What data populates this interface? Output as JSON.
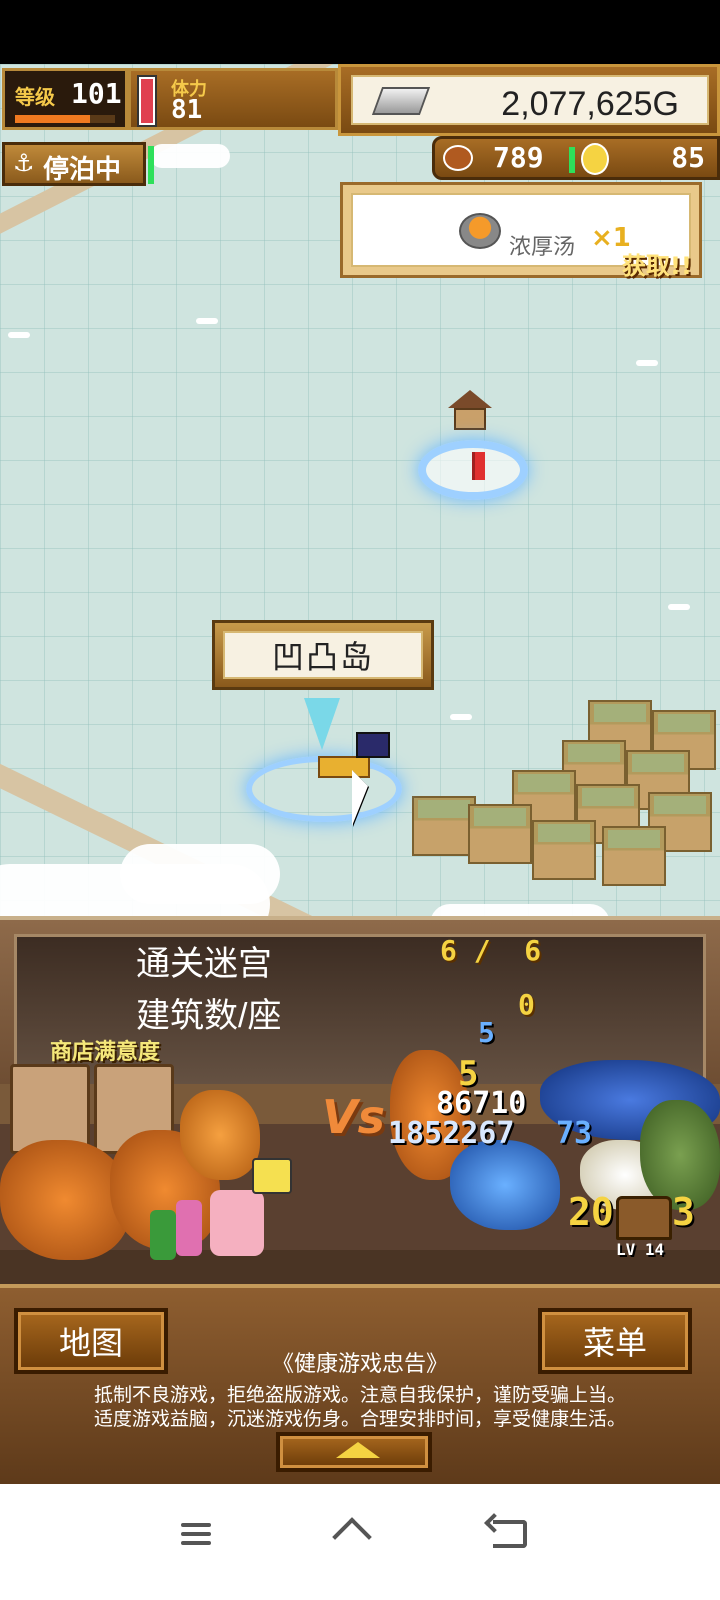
{
  "hud": {
    "level_label": "等级",
    "level_value": "101",
    "level_progress": 0.75,
    "stamina_label": "体力",
    "stamina_value": "81",
    "stamina_fill": 0.92,
    "gold": "2,077,625G",
    "anchor_status": "停泊中",
    "meat_count": "789",
    "coin_count": "85"
  },
  "notice": {
    "item_name": "浓厚汤",
    "quantity": "×1",
    "claim_label": "获取!!"
  },
  "map": {
    "island_name": "凹凸岛"
  },
  "stats": {
    "dungeon_label": "通关迷宫",
    "dungeon_value": "6 /  6",
    "building_label": "建筑数/座",
    "building_value": "0",
    "shop_satisfaction_label": "商店满意度"
  },
  "battle": {
    "vs_label": "Vs",
    "damage_numbers": [
      "5",
      "5",
      "86710",
      "1852267",
      "73",
      "20",
      "3"
    ],
    "enemy_level": "LV 14"
  },
  "bottom": {
    "map_button": "地图",
    "menu_button": "菜单",
    "advisory_title": "《健康游戏忠告》",
    "advisory_line1": "抵制不良游戏，拒绝盗版游戏。注意自我保护，谨防受骗上当。",
    "advisory_line2": "适度游戏益脑，沉迷游戏伤身。合理安排时间，享受健康生活。"
  },
  "colors": {
    "wood": "#8a5a1c",
    "gold_text": "#f5d342",
    "map_sea": "#cfe4df",
    "marker_glow": "#9ed0ff"
  },
  "icons": {
    "nav_menu": "menu-icon",
    "nav_home": "home-icon",
    "nav_back": "back-icon"
  }
}
